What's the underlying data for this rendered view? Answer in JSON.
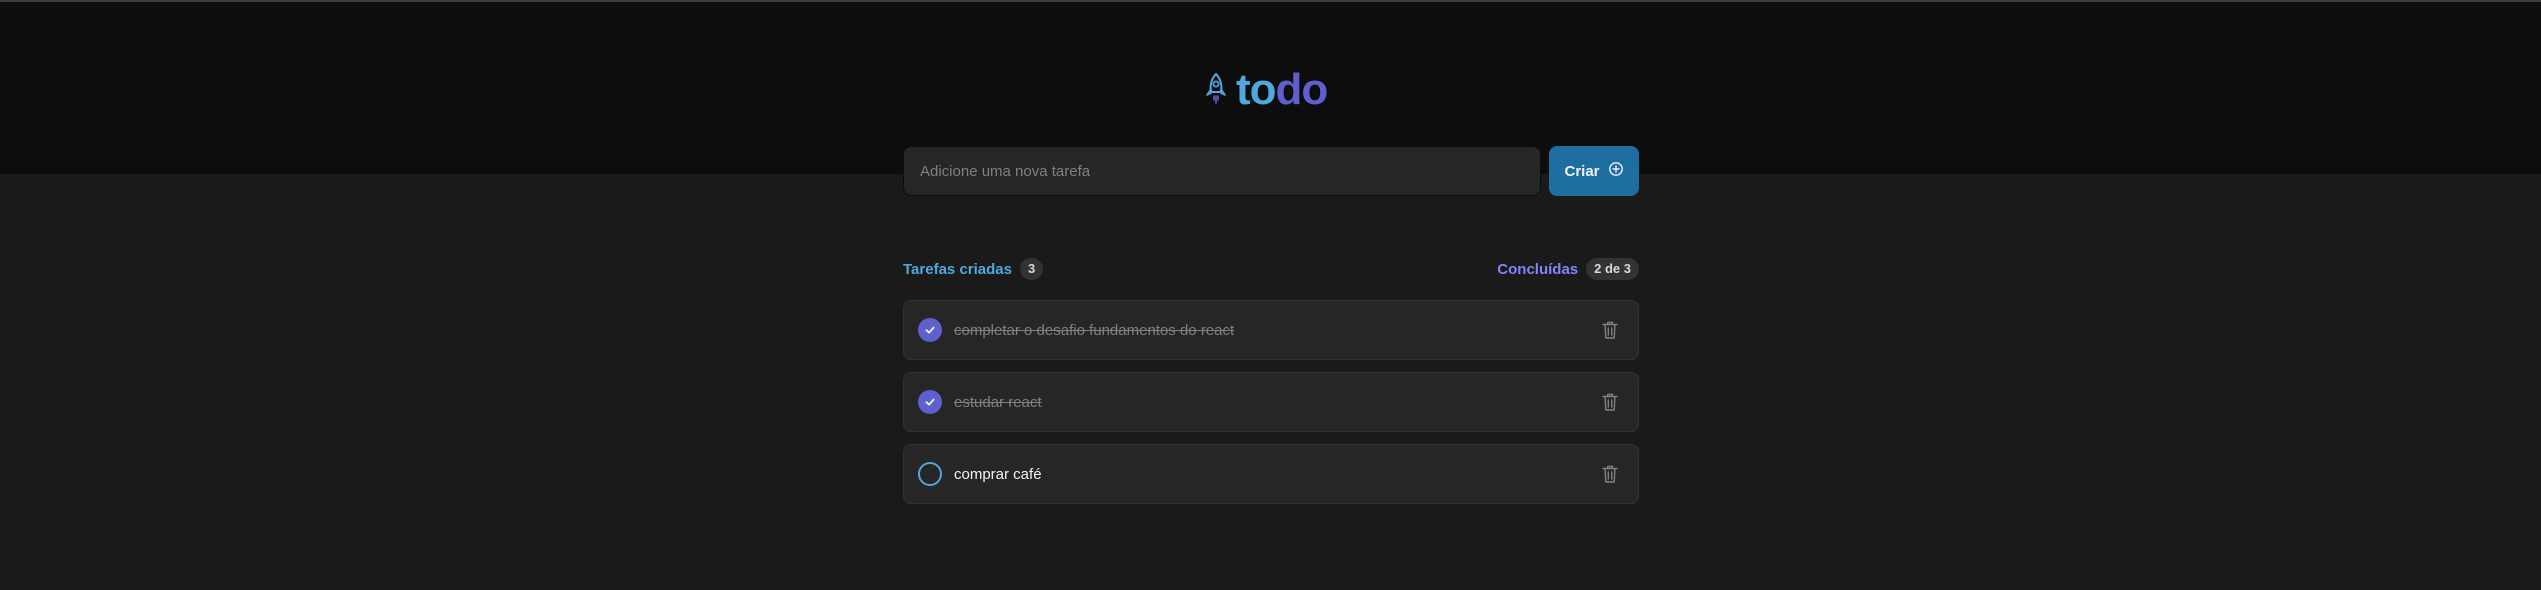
{
  "logo": {
    "text_to": "to",
    "text_do": "do",
    "icon": "rocket-icon"
  },
  "new_task": {
    "placeholder": "Adicione uma nova tarefa",
    "value": "",
    "button_label": "Criar",
    "button_icon": "plus-circle-icon"
  },
  "counters": {
    "created_label": "Tarefas criadas",
    "created_count": "3",
    "done_label": "Concluídas",
    "done_count": "2 de 3"
  },
  "tasks": [
    {
      "text": "completar o desafio fundamentos do react",
      "completed": true
    },
    {
      "text": "estudar react",
      "completed": true
    },
    {
      "text": "comprar café",
      "completed": false
    }
  ],
  "colors": {
    "blue": "#4ea8de",
    "purple": "#5e60ce",
    "purple_light": "#8284fa",
    "button": "#1e6f9f",
    "header_bg": "#0d0d0d",
    "body_bg": "#1a1a1a",
    "card_bg": "#262626"
  }
}
